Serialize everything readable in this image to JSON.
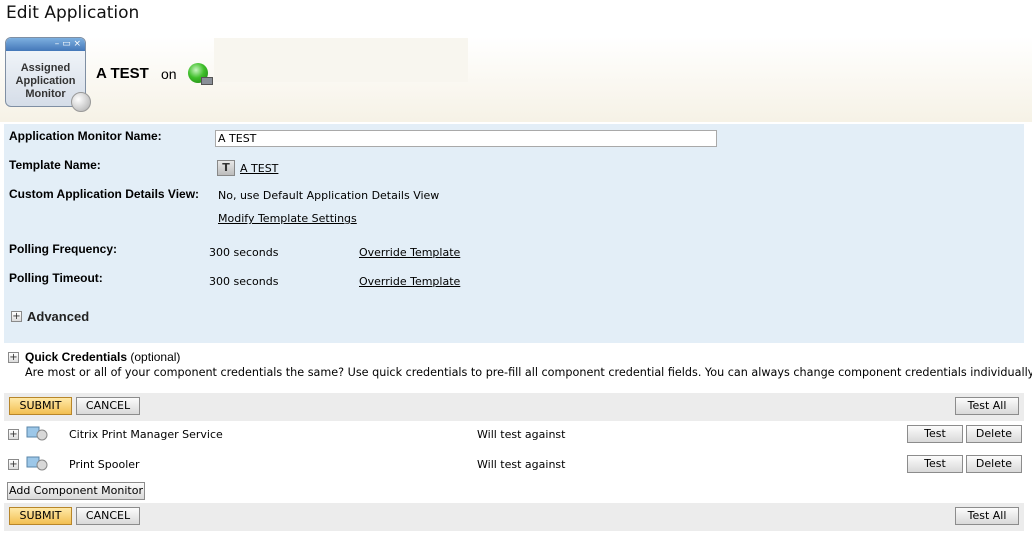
{
  "page": {
    "title": "Edit Application"
  },
  "header": {
    "icon_label_line1": "Assigned",
    "icon_label_line2": "Application",
    "icon_label_line3": "Monitor",
    "app_name": "A TEST",
    "on_text": "on"
  },
  "form": {
    "monitor_name_label": "Application Monitor Name:",
    "monitor_name_value": "A TEST",
    "template_name_label": "Template Name:",
    "template_name_value": "A TEST",
    "custom_view_label": "Custom Application Details View:",
    "custom_view_value": "No, use Default Application Details View",
    "modify_template_link": "Modify Template Settings",
    "polling_frequency_label": "Polling Frequency:",
    "polling_frequency_value": "300 seconds",
    "polling_timeout_label": "Polling Timeout:",
    "polling_timeout_value": "300 seconds",
    "override_link": "Override Template",
    "advanced_label": "Advanced"
  },
  "quick_credentials": {
    "title": "Quick Credentials",
    "optional": "(optional)",
    "description": "Are most or all of your component credentials the same? Use quick credentials to pre-fill all component credential fields. You can always change component credentials individually."
  },
  "actions": {
    "submit": "SUBMIT",
    "cancel": "CANCEL",
    "test_all": "Test All",
    "test": "Test",
    "delete": "Delete",
    "add_component": "Add Component Monitor"
  },
  "components": [
    {
      "name": "Citrix Print Manager Service",
      "status": "Will test against"
    },
    {
      "name": "Print Spooler",
      "status": "Will test against"
    }
  ],
  "colors": {
    "form_panel": "#e3eef7",
    "submit_button": "#f2bf52",
    "status_ok": "#3fbf2a"
  }
}
